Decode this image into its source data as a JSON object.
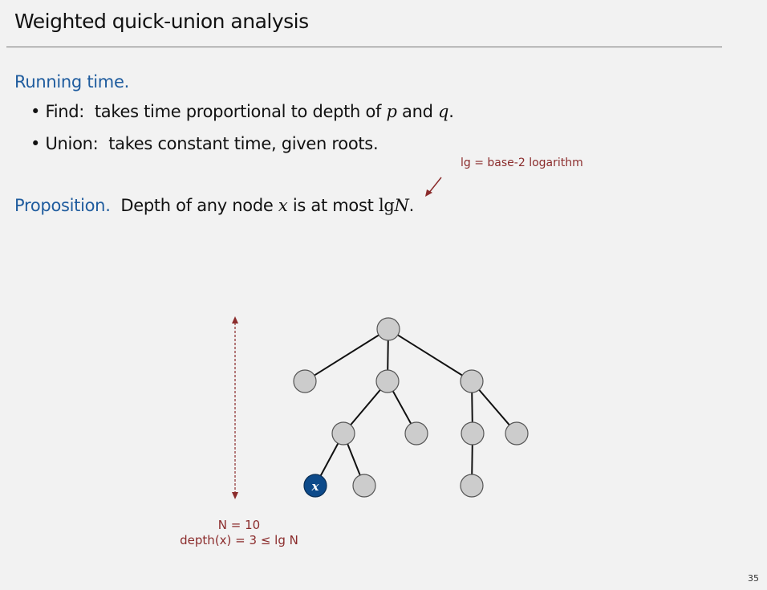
{
  "slide": {
    "title": "Weighted quick-union analysis",
    "running_time_heading": "Running time.",
    "bullets": [
      {
        "label": "Find:",
        "text_before": "takes time proportional to depth of",
        "var1": "p",
        "and": "and",
        "var2": "q",
        "end": "."
      },
      {
        "label": "Union:",
        "text": "takes constant time, given roots."
      }
    ],
    "annotation": "lg = base-2 logarithm",
    "proposition": {
      "label": "Proposition.",
      "text_before": "Depth of any node",
      "var": "x",
      "text_after": "is at most",
      "lg": "lg",
      "N": "N",
      "end": "."
    },
    "diagram": {
      "node_label": "x",
      "caption_line1": "N = 10",
      "caption_line2": "depth(x) = 3 ≤  lg N",
      "colors": {
        "node": "#cccccc",
        "highlight": "#0d4a8a",
        "arrow": "#8b2c2c"
      }
    },
    "page_number": "35"
  }
}
